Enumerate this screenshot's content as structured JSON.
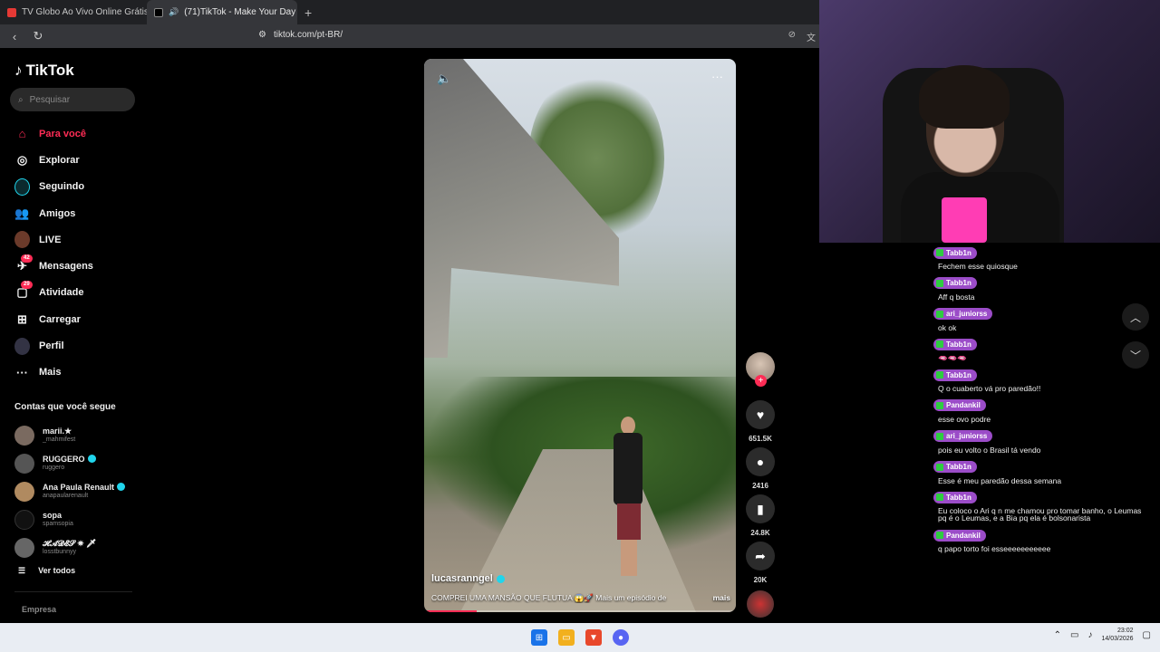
{
  "browser": {
    "tabs": [
      {
        "title": "TV Globo Ao Vivo Online Grátis | Ass",
        "active": false
      },
      {
        "title": "(71)TikTok - Make Your Day",
        "active": true
      }
    ],
    "url": "tiktok.com/pt-BR/"
  },
  "sidebar": {
    "logo": "TikTok",
    "search_placeholder": "Pesquisar",
    "nav": [
      {
        "label": "Para você",
        "icon": "home-icon"
      },
      {
        "label": "Explorar",
        "icon": "compass-icon"
      },
      {
        "label": "Seguindo",
        "icon": "following-icon"
      },
      {
        "label": "Amigos",
        "icon": "friends-icon"
      },
      {
        "label": "LIVE",
        "icon": "live-icon"
      },
      {
        "label": "Mensagens",
        "icon": "messages-icon",
        "badge": "42"
      },
      {
        "label": "Atividade",
        "icon": "activity-icon",
        "badge": "29"
      },
      {
        "label": "Carregar",
        "icon": "upload-icon"
      },
      {
        "label": "Perfil",
        "icon": "profile-icon"
      },
      {
        "label": "Mais",
        "icon": "more-icon"
      }
    ],
    "following_title": "Contas que você segue",
    "following": [
      {
        "name": "marii.★",
        "user": "_mahmifest"
      },
      {
        "name": "RUGGERO",
        "user": "ruggero",
        "verified": true
      },
      {
        "name": "Ana Paula Renault",
        "user": "anapaularenault",
        "verified": true
      },
      {
        "name": "sopa",
        "user": "spamsopia"
      },
      {
        "name": "𝓗𝓐𝓓𝓔𝓢 ✵ 🗡",
        "user": "losstbunnyy"
      }
    ],
    "see_all": "Ver todos",
    "footer": "Empresa"
  },
  "video": {
    "author": "lucasranngel",
    "caption": "COMPREI UMA MANSÃO QUE FLUTUA 😱🚀 Mais um episódio de",
    "more": "mais",
    "progress": 0.17,
    "likes": "651.5K",
    "comments": "2416",
    "saves": "24.8K",
    "shares": "20K"
  },
  "chat": [
    {
      "user": "Tabb1n",
      "text": "Fechem esse quiosque"
    },
    {
      "user": "Tabb1n",
      "text": "Aff q bosta"
    },
    {
      "user": "ari_juniorss",
      "text": "ok ok"
    },
    {
      "user": "Tabb1n",
      "text": "🫦🫦🫦"
    },
    {
      "user": "Tabb1n",
      "text": "Q o cuaberto vá pro paredão!!"
    },
    {
      "user": "Pandankil",
      "text": "esse ovo podre"
    },
    {
      "user": "ari_juniorss",
      "text": "pois eu volto o Brasil tá vendo"
    },
    {
      "user": "Tabb1n",
      "text": "Esse é meu paredão dessa semana"
    },
    {
      "user": "Tabb1n",
      "text": "Eu coloco o Ari q n me chamou pro tomar banho, o Leumas pq é o Leumas, e a Bia pq ela é bolsonarista"
    },
    {
      "user": "Pandankil",
      "text": "q papo torto foi esseeeeeeeeeee"
    }
  ],
  "taskbar": {
    "time": "23:02",
    "date": "14/03/2026"
  },
  "colors": {
    "accent": "#fe2c55",
    "chat_user_bg": "#9b4cc8"
  }
}
